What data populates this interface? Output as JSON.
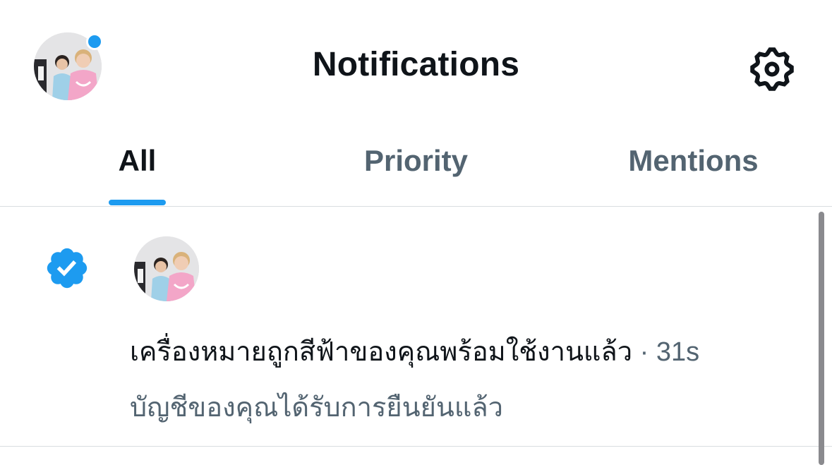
{
  "header": {
    "title": "Notifications",
    "avatar_icon": "profile-avatar",
    "settings_icon": "gear-icon",
    "unread_indicator_color": "#1d9bf0"
  },
  "tabs": [
    {
      "label": "All",
      "active": true
    },
    {
      "label": "Priority",
      "active": false
    },
    {
      "label": "Mentions",
      "active": false
    }
  ],
  "notification": {
    "icon": "verified-badge-icon",
    "headline": "เครื่องหมายถูกสีฟ้าของคุณพร้อมใช้งานแล้ว",
    "separator": " · ",
    "time": "31s",
    "subtext": "บัญชีของคุณได้รับการยืนยันแล้ว"
  },
  "colors": {
    "accent": "#1d9bf0",
    "text_primary": "#0f1419",
    "text_secondary": "#536471"
  }
}
